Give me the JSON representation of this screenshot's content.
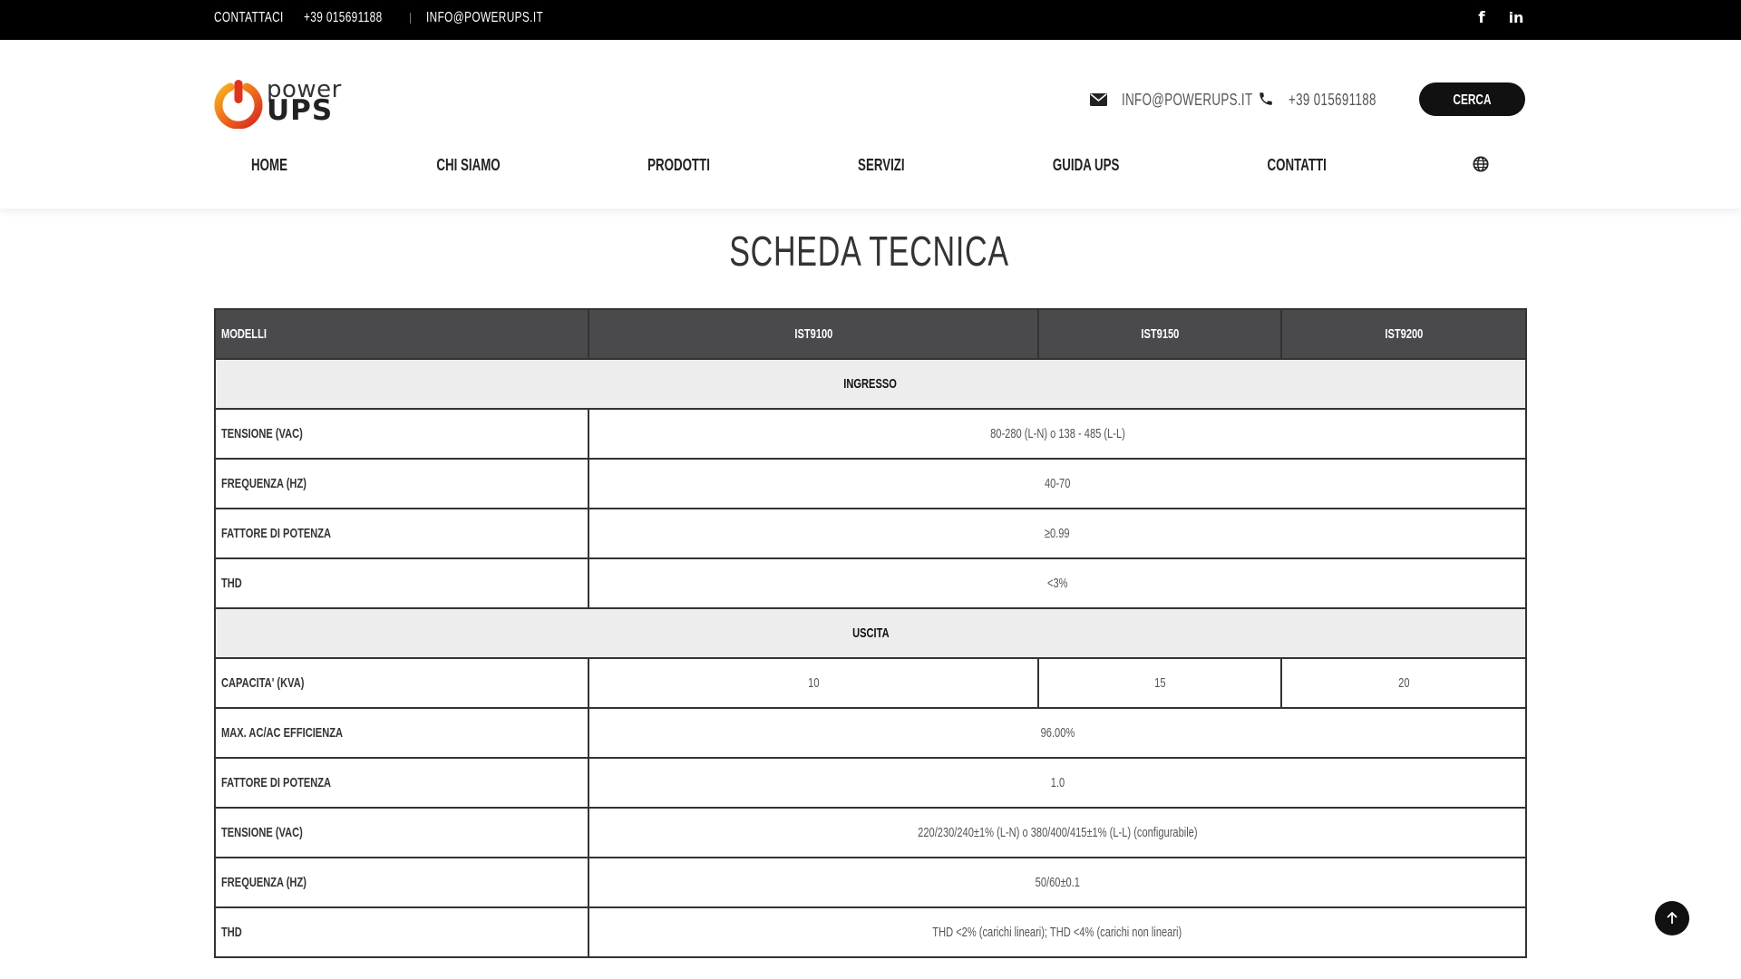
{
  "topbar": {
    "contact_label": "CONTATTACI",
    "phone": "+39 015691188",
    "email": "INFO@POWERUPS.IT",
    "social": [
      {
        "icon": "facebook-icon",
        "glyph": "f"
      },
      {
        "icon": "linkedin-icon",
        "glyph": "in"
      }
    ]
  },
  "header": {
    "logo": {
      "line1": "power",
      "line2": "UPS"
    },
    "email": "INFO@POWERUPS.IT",
    "phone": "+39 015691188",
    "search_button": "CERCA"
  },
  "nav": {
    "items": [
      "HOME",
      "CHI SIAMO",
      "PRODOTTI",
      "SERVIZI",
      "GUIDA UPS",
      "CONTATTI"
    ],
    "language_icon": "globe-icon"
  },
  "page": {
    "title": "SCHEDA TECNICA"
  },
  "table": {
    "headers": [
      "MODELLI",
      "IST9100",
      "IST9150",
      "IST9200"
    ],
    "section_input": "INGRESSO",
    "input_rows": [
      {
        "label": "TENSIONE (VAC)",
        "value": "80-280 (L-N) o 138 - 485 (L-L)"
      },
      {
        "label": "FREQUENZA (HZ)",
        "value": "40-70"
      },
      {
        "label": "FATTORE DI POTENZA",
        "value": "≥0.99"
      },
      {
        "label": "THD",
        "value": "<3%"
      }
    ],
    "section_output": "USCITA",
    "capacity_row": {
      "label": "CAPACITA' (KVA)",
      "values": [
        "10",
        "15",
        "20"
      ]
    },
    "output_rows": [
      {
        "label": "MAX. AC/AC EFFICIENZA",
        "value": "96.00%"
      },
      {
        "label": "FATTORE DI POTENZA",
        "value": "1.0"
      },
      {
        "label": "TENSIONE (VAC)",
        "value": "220/230/240±1% (L-N) o 380/400/415±1% (L-L) (configurabile)"
      },
      {
        "label": "FREQUENZA (HZ)",
        "value": "50/60±0.1"
      },
      {
        "label": "THD",
        "value": "THD <2% (carichi lineari); THD <4% (carichi non lineari)"
      }
    ]
  },
  "back_to_top_icon": "arrow-up-icon"
}
